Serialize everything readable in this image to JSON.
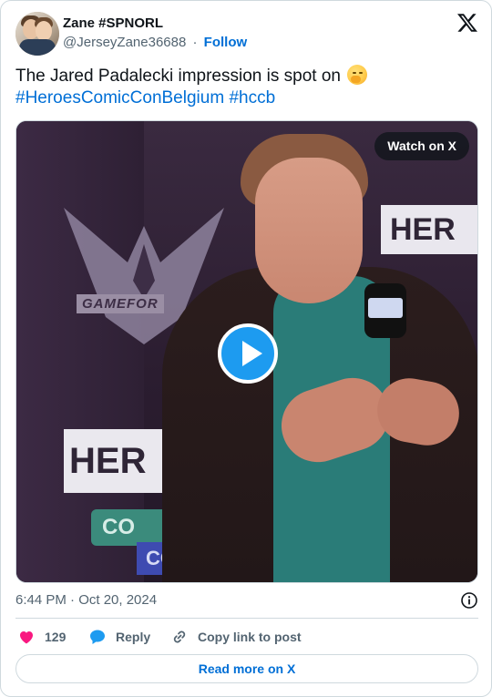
{
  "author": {
    "name": "Zane #SPNORL",
    "handle": "@JerseyZane36688",
    "separator": "·",
    "follow_label": "Follow"
  },
  "tweet": {
    "text": "The Jared Padalecki impression is spot on",
    "emoji": "face-with-hand-over-mouth",
    "hashtags": [
      "#HeroesComicConBelgium",
      "#hccb"
    ]
  },
  "media": {
    "watch_label": "Watch on X",
    "left_logo_text": "GAMEFOR",
    "sign_left": "HER",
    "sign_right": "HER",
    "con_teal": "CO",
    "con_blue": "CON"
  },
  "meta": {
    "timestamp": "6:44 PM · Oct 20, 2024"
  },
  "actions": {
    "like_count": "129",
    "reply_label": "Reply",
    "copy_label": "Copy link to post"
  },
  "footer": {
    "read_more_label": "Read more on X"
  },
  "colors": {
    "link": "#006fd6",
    "muted": "#536471",
    "border": "#cfd9de",
    "like": "#f91880",
    "reply": "#1d9bf0",
    "play": "#1d9bf0"
  }
}
